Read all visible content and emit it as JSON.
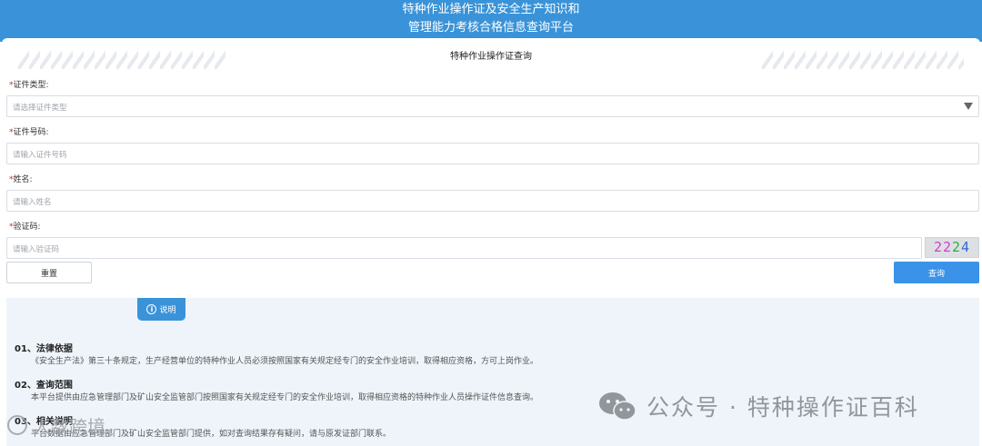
{
  "header": {
    "title_line1": "特种作业操作证及安全生产知识和",
    "title_line2": "管理能力考核合格信息查询平台"
  },
  "form": {
    "title": "特种作业操作证查询",
    "required_mark": "*",
    "cert_type": {
      "label": "证件类型:",
      "placeholder": "请选择证件类型"
    },
    "cert_no": {
      "label": "证件号码:",
      "placeholder": "请输入证件号码"
    },
    "name": {
      "label": "姓名:",
      "placeholder": "请输入姓名"
    },
    "captcha": {
      "label": "验证码:",
      "placeholder": "请输入验证码",
      "image_chars": [
        "2",
        "2",
        "2",
        "4"
      ]
    },
    "reset_label": "重置",
    "query_label": "查询"
  },
  "info": {
    "tab_label": "说明",
    "sections": [
      {
        "title": "01、法律依据",
        "body": "《安全生产法》第三十条规定，生产经营单位的特种作业人员必须按照国家有关规定经专门的安全作业培训，取得相应资格，方可上岗作业。"
      },
      {
        "title": "02、查询范围",
        "body": "本平台提供由应急管理部门及矿山安全监管部门按照国家有关规定经专门的安全作业培训，取得相应资格的特种作业人员操作证件信息查询。"
      },
      {
        "title": "03、相关说明",
        "body": "平台数据由应急管理部门及矿山安全监管部门提供，如对查询结果存有疑问，请与原发证部门联系。"
      }
    ]
  },
  "watermark": {
    "text": "公众号 · 特种操作证百科",
    "source_text": "人数跨境"
  },
  "colors": {
    "header_blue": "#3a93d8",
    "button_blue": "#3a93e8",
    "required_red": "#e02020",
    "info_bg": "#eef4fa"
  }
}
